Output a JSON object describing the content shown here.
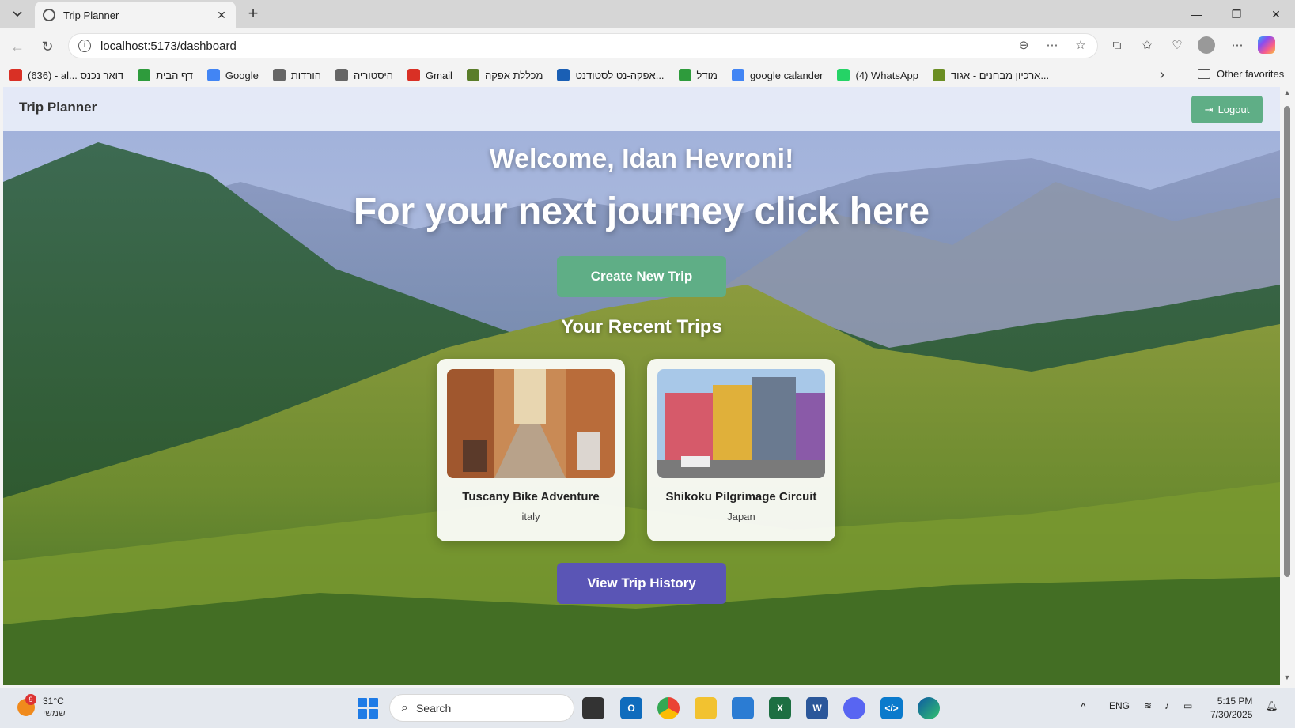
{
  "browser": {
    "tab_title": "Trip Planner",
    "url": "localhost:5173/dashboard",
    "bookmarks": [
      {
        "label": "(636) - al... דואר נכנס",
        "icon": "gmail-icon",
        "color": "#d93025"
      },
      {
        "label": "דף הבית",
        "icon": "moodle-icon",
        "color": "#2e9b3c"
      },
      {
        "label": "Google",
        "icon": "google-icon",
        "color": "#4285f4"
      },
      {
        "label": "הורדות",
        "icon": "globe-icon",
        "color": "#666666"
      },
      {
        "label": "היסטוריה",
        "icon": "globe-icon",
        "color": "#666666"
      },
      {
        "label": "Gmail",
        "icon": "gmail-icon",
        "color": "#d93025"
      },
      {
        "label": "מכללת אפקה",
        "icon": "afeka-icon",
        "color": "#5a7d2a"
      },
      {
        "label": "אפקה-נט לסטודנט...",
        "icon": "afeka-net-icon",
        "color": "#1a5fb4"
      },
      {
        "label": "מודל",
        "icon": "moodle-icon",
        "color": "#2e9b3c"
      },
      {
        "label": "google calander",
        "icon": "calendar-icon",
        "color": "#4285f4"
      },
      {
        "label": "(4) WhatsApp",
        "icon": "whatsapp-icon",
        "color": "#25d366"
      },
      {
        "label": "ארכיון מבחנים - אגוד...",
        "icon": "archive-icon",
        "color": "#6b8e23"
      }
    ],
    "other_favorites": "Other favorites"
  },
  "app": {
    "brand": "Trip Planner",
    "logout_label": "Logout",
    "welcome": "Welcome, Idan Hevroni!",
    "tagline": "For your next journey click here",
    "create_label": "Create New Trip",
    "recent_title": "Your Recent Trips",
    "trips": [
      {
        "title": "Tuscany Bike Adventure",
        "country": "italy"
      },
      {
        "title": "Shikoku Pilgrimage Circuit",
        "country": "Japan"
      }
    ],
    "history_label": "View Trip History"
  },
  "taskbar": {
    "weather_temp": "31°C",
    "weather_desc": "שמשי",
    "weather_badge": "9",
    "search_placeholder": "Search",
    "lang": "ENG",
    "time": "5:15 PM",
    "date": "7/30/2025"
  }
}
